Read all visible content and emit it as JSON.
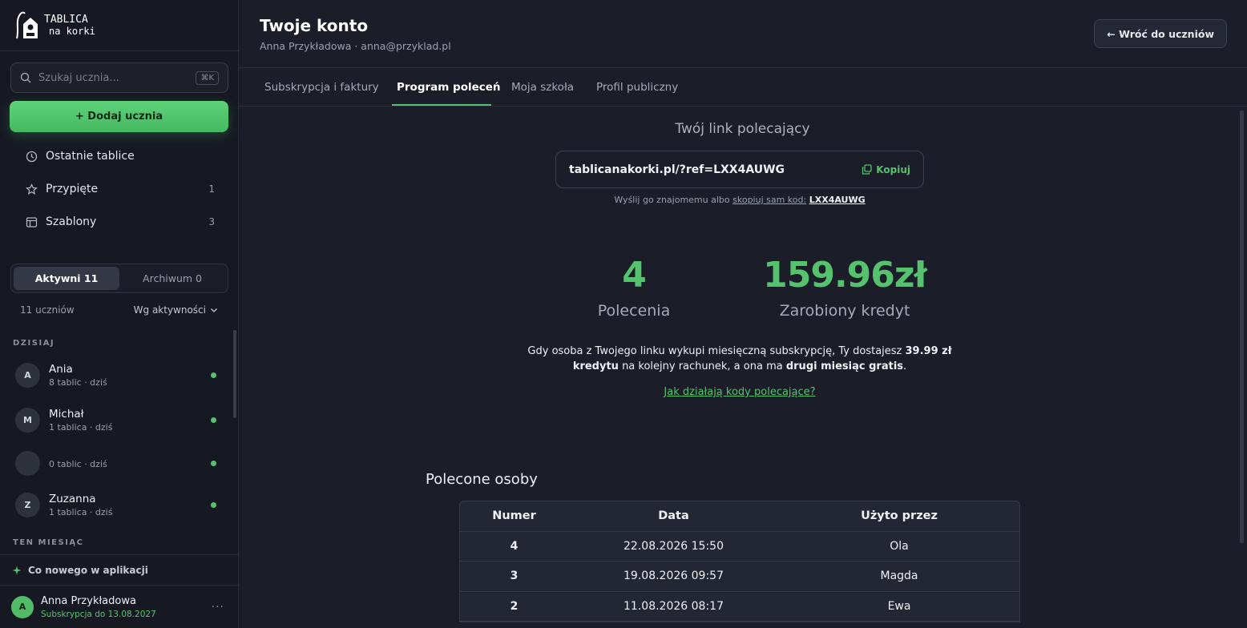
{
  "sidebar": {
    "logo": {
      "line1": "TABLICA",
      "line2": "na korki"
    },
    "search": {
      "placeholder": "Szukaj ucznia...",
      "shortcut": "⌘K"
    },
    "add_student_label": "+ Dodaj ucznia",
    "nav": [
      {
        "label": "Ostatnie tablice",
        "count": "",
        "icon": "clock-icon"
      },
      {
        "label": "Przypięte",
        "count": "1",
        "icon": "star-icon"
      },
      {
        "label": "Szablony",
        "count": "3",
        "icon": "layout-icon"
      }
    ],
    "segment": {
      "active": "Aktywni 11",
      "archive": "Archiwum 0"
    },
    "list_count": "11 uczniów",
    "sort_label": "Wg aktywności",
    "groups": {
      "today": "DZISIAJ",
      "this_month": "TEN MIESIĄC"
    },
    "students": [
      {
        "initial": "A",
        "name": "Ania",
        "meta": "8 tablic · dziś",
        "online": true
      },
      {
        "initial": "M",
        "name": "Michał",
        "meta": "1 tablica · dziś",
        "online": true
      },
      {
        "initial": "",
        "name": "",
        "meta": "0 tablic · dziś",
        "online": true
      },
      {
        "initial": "Z",
        "name": "Zuzanna",
        "meta": "1 tablica · dziś",
        "online": true
      }
    ],
    "whats_new": "Co nowego w aplikacji",
    "user": {
      "initial": "A",
      "name": "Anna Przykładowa",
      "subscription": "Subskrypcja do 13.08.2027"
    }
  },
  "header": {
    "title": "Twoje konto",
    "subtitle": "Anna Przykładowa · anna@przyklad.pl",
    "back_label": "← Wróć do uczniów"
  },
  "tabs": [
    "Subskrypcja i faktury",
    "Program poleceń",
    "Moja szkoła",
    "Profil publiczny"
  ],
  "active_tab": "Program poleceń",
  "referral": {
    "title": "Twój link polecający",
    "link": "tablicanakorki.pl/?ref=LXX4AUWG",
    "copy_label": "Kopiuj",
    "hint_prefix": "Wyślij go znajomemu albo ",
    "hint_link": "skopiuj sam kod:",
    "code": "LXX4AUWG",
    "stats": {
      "referrals_value": "4",
      "referrals_label": "Polecenia",
      "credit_value": "159.96zł",
      "credit_label": "Zarobiony kredyt"
    },
    "desc_1": "Gdy osoba z Twojego linku wykupi miesięczną subskrypcję, Ty dostajesz ",
    "desc_bold_1": "39.99 zł kredytu",
    "desc_2": " na kolejny rachunek, a ona ma ",
    "desc_bold_2": "drugi miesiąc gratis",
    "desc_3": ".",
    "help_link": "Jak działają kody polecające?"
  },
  "referred": {
    "title": "Polecone osoby",
    "columns": [
      "Numer",
      "Data",
      "Użyto przez"
    ],
    "rows": [
      [
        "4",
        "22.08.2026 15:50",
        "Ola"
      ],
      [
        "3",
        "19.08.2026 09:57",
        "Magda"
      ],
      [
        "2",
        "11.08.2026 08:17",
        "Ewa"
      ]
    ]
  },
  "colors": {
    "accent": "#55c26d",
    "bg": "#1b1e29",
    "sidebar": "#161922"
  }
}
